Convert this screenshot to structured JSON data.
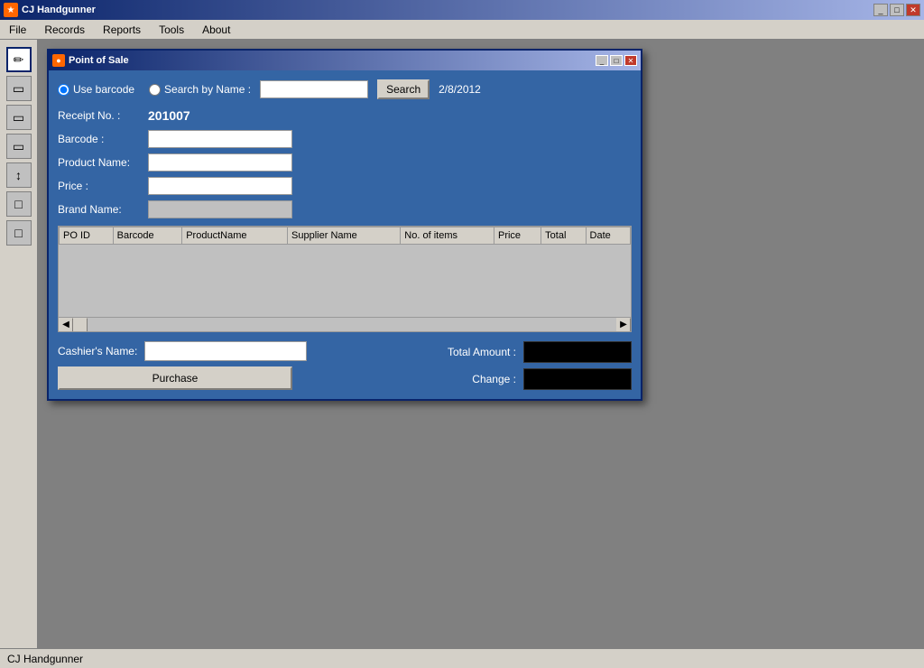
{
  "app": {
    "title": "CJ Handgunner",
    "icon": "★",
    "status_text": "CJ Handgunner"
  },
  "menu": {
    "items": [
      "File",
      "Records",
      "Reports",
      "Tools",
      "About"
    ]
  },
  "sidebar": {
    "icons": [
      "✏️",
      "📋",
      "📋",
      "📋",
      "↕",
      "□",
      "□"
    ]
  },
  "modal": {
    "title": "Point of Sale",
    "icon": "●"
  },
  "form": {
    "use_barcode_label": "Use barcode",
    "search_by_name_label": "Search by Name :",
    "search_name_placeholder": "",
    "search_btn_label": "Search",
    "date": "2/8/2012",
    "receipt_label": "Receipt No. :",
    "receipt_value": "201007",
    "barcode_label": "Barcode :",
    "product_name_label": "Product Name:",
    "price_label": "Price :",
    "brand_name_label": "Brand Name:",
    "cashier_label": "Cashier's Name:",
    "total_amount_label": "Total Amount :",
    "change_label": "Change :",
    "purchase_btn_label": "Purchase"
  },
  "table": {
    "columns": [
      "PO ID",
      "Barcode",
      "ProductName",
      "Supplier Name",
      "No. of items",
      "Price",
      "Total",
      "Date"
    ],
    "rows": []
  },
  "title_buttons": {
    "minimize": "_",
    "restore": "□",
    "close": "✕"
  }
}
